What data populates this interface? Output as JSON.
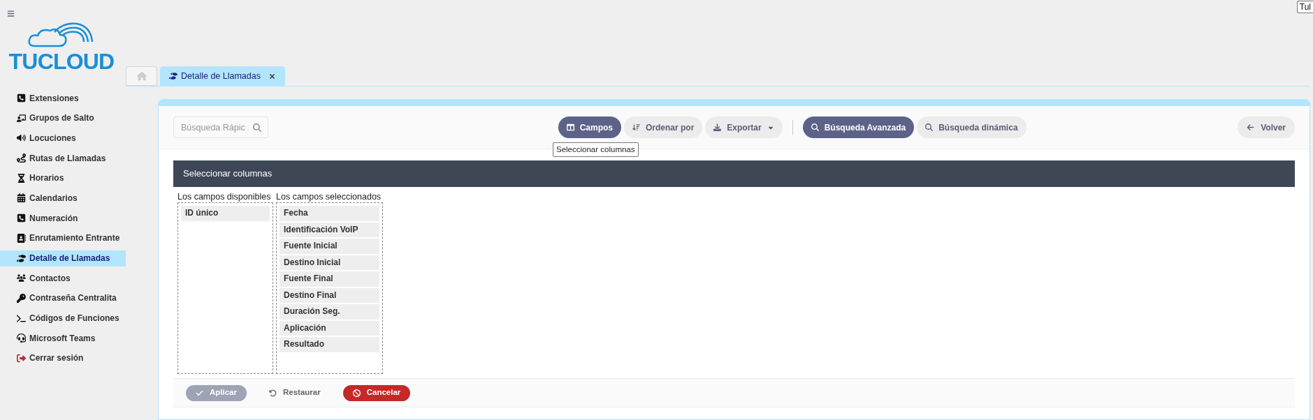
{
  "corner_tooltip": "Tul",
  "logo": {
    "text": "TUCLOUD"
  },
  "sidebar": {
    "items": [
      {
        "label": "Extensiones",
        "selected": false
      },
      {
        "label": "Grupos de Salto",
        "selected": false
      },
      {
        "label": "Locuciones",
        "selected": false
      },
      {
        "label": "Rutas de Llamadas",
        "selected": false
      },
      {
        "label": "Horarios",
        "selected": false
      },
      {
        "label": "Calendarios",
        "selected": false
      },
      {
        "label": "Numeración",
        "selected": false
      },
      {
        "label": "Enrutamiento Entrante",
        "selected": false
      },
      {
        "label": "Detalle de Llamadas",
        "selected": true
      },
      {
        "label": "Contactos",
        "selected": false
      },
      {
        "label": "Contraseña Centralita",
        "selected": false
      },
      {
        "label": "Códigos de Funciones",
        "selected": false
      },
      {
        "label": "Microsoft Teams",
        "selected": false
      },
      {
        "label": "Cerrar sesión",
        "selected": false
      }
    ]
  },
  "tabs": [
    {
      "kind": "home",
      "selected": false
    },
    {
      "kind": "page",
      "label": "Detalle de Llamadas",
      "selected": true
    }
  ],
  "toolbar": {
    "search": {
      "placeholder": "Búsqueda Rápic"
    },
    "buttons": [
      {
        "kind": "columns",
        "label": "Campos",
        "active": true,
        "menu": false
      },
      {
        "kind": "sort",
        "label": "Ordenar por",
        "active": false,
        "menu": false
      },
      {
        "kind": "export",
        "label": "Exportar",
        "active": false,
        "menu": true
      },
      {
        "kind": "separator"
      },
      {
        "kind": "search",
        "label": "Búsqueda Avanzada",
        "active": true,
        "menu": false
      },
      {
        "kind": "search",
        "label": "Búsqueda dinámica",
        "active": false,
        "menu": false
      }
    ],
    "back": {
      "label": "Volver"
    },
    "tooltip": "Seleccionar columnas"
  },
  "panel": {
    "title": "Seleccionar columnas",
    "available": {
      "label": "Los campos disponibles",
      "items": [
        "ID único"
      ]
    },
    "chosen": {
      "label": "Los campos seleccionados",
      "items": [
        "Fecha",
        "Identificación VoIP",
        "Fuente Inicial",
        "Destino Inicial",
        "Fuente Final",
        "Destino Final",
        "Duración Seg.",
        "Aplicación",
        "Resultado"
      ]
    },
    "actions": [
      {
        "kind": "apply",
        "label": "Aplicar",
        "disabled": true
      },
      {
        "kind": "reset",
        "label": "Restaurar",
        "disabled": false
      },
      {
        "kind": "cancel",
        "label": "Cancelar",
        "disabled": false
      }
    ]
  }
}
